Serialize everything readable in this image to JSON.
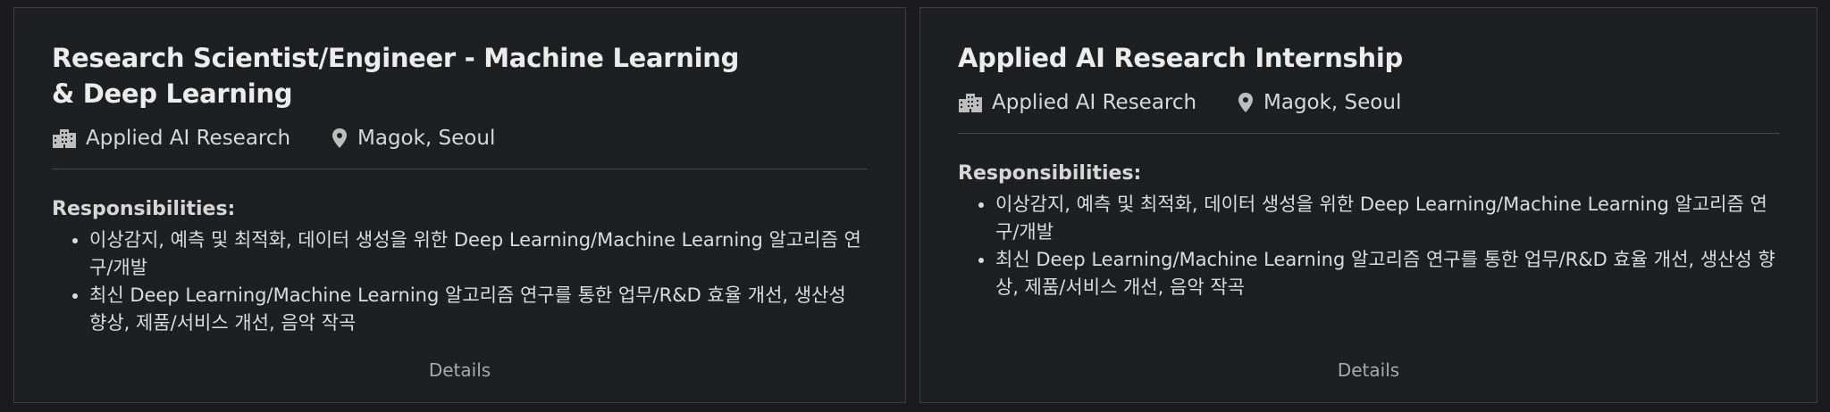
{
  "cards": [
    {
      "title": "Research Scientist/Engineer - Machine Learning & Deep Learning",
      "company": "Applied AI Research",
      "location": "Magok, Seoul",
      "responsibilities_heading": "Responsibilities:",
      "responsibilities": [
        "이상감지, 예측 및 최적화, 데이터 생성을 위한 Deep Learning/Machine Learning 알고리즘 연구/개발",
        "최신 Deep Learning/Machine Learning 알고리즘 연구를 통한 업무/R&D 효율 개선, 생산성 향상, 제품/서비스 개선, 음악 작곡"
      ],
      "details_label": "Details"
    },
    {
      "title": "Applied AI Research Internship",
      "company": "Applied AI Research",
      "location": "Magok, Seoul",
      "responsibilities_heading": "Responsibilities:",
      "responsibilities": [
        "이상감지, 예측 및 최적화, 데이터 생성을 위한 Deep Learning/Machine Learning 알고리즘 연구/개발",
        "최신 Deep Learning/Machine Learning 알고리즘 연구를 통한 업무/R&D 효율 개선, 생산성 향상, 제품/서비스 개선, 음악 작곡"
      ],
      "details_label": "Details"
    }
  ],
  "icons": {
    "company": "building-icon",
    "location": "map-pin-icon"
  },
  "colors": {
    "background": "#1b1b1d",
    "card_border": "#3e3e42",
    "text": "#e6e6e6",
    "muted": "#a9a9ad"
  }
}
